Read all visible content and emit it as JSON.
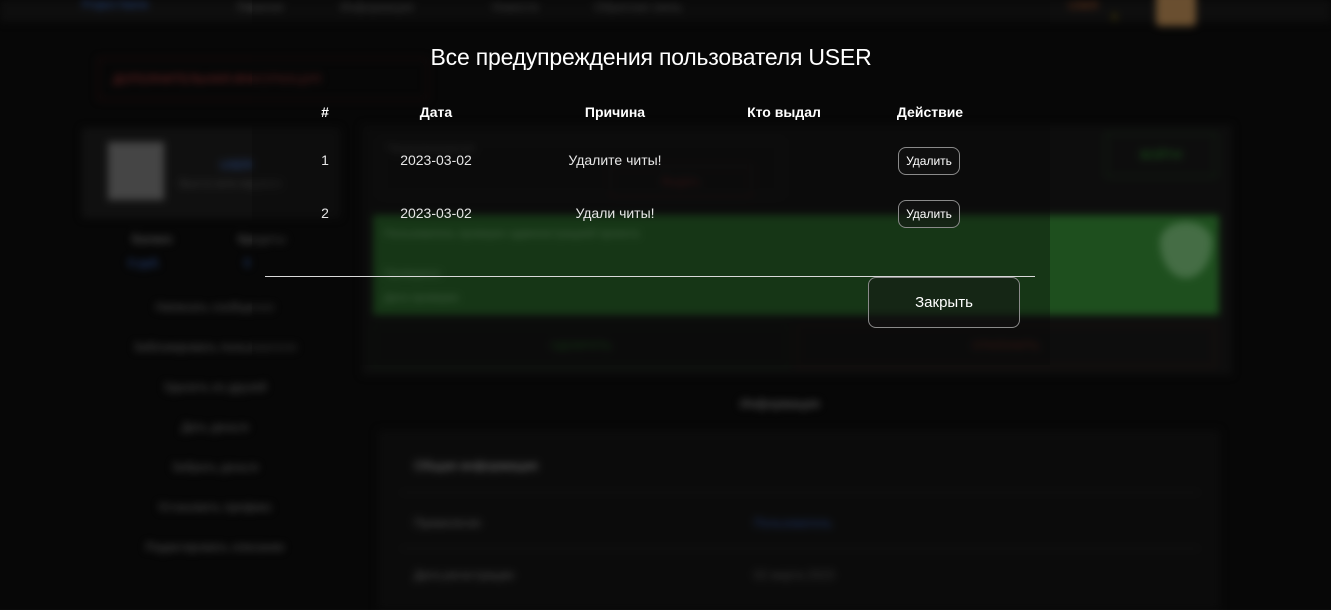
{
  "background": {
    "logo": "Project Name",
    "nav": [
      "Главная",
      "Информация",
      "Новости",
      "Обратная связь"
    ],
    "user_top": "USER",
    "gold": "0",
    "alert": "ДОПОЛНИТЕЛЬНАЯ ИНФОРМАЦИЯ",
    "profile": {
      "name": "USER",
      "subtitle": "Был в сети недавно",
      "stats": [
        {
          "label": "Баланс",
          "value": "0 руб."
        },
        {
          "label": "Кредиты",
          "value": "0"
        }
      ]
    },
    "left_menu": [
      "Написать сообщение",
      "Заблокировать пользователя",
      "Удалить из друзей",
      "Дать деньги",
      "Забрать деньги",
      "Установить префикс",
      "Редактировать описание"
    ],
    "main": {
      "field_label": "Предупреждения",
      "red_small": "Выдать",
      "green_btn": "ВОЙТИ",
      "green_lines": [
        "Пользователь проверен администрацией проекта",
        "Проверено",
        "Дата проверки"
      ],
      "green_action": "ОДОБРИТЬ",
      "red_action": "ОТКЛОНИТЬ"
    },
    "info": {
      "title": "Информация",
      "header": "Общая информация",
      "rows": [
        {
          "label": "Привилегия",
          "value": "Пользователь"
        },
        {
          "label": "Дата регистрации",
          "value": "02 марта 2023"
        }
      ]
    }
  },
  "modal": {
    "title": "Все предупреждения пользователя USER",
    "columns": [
      "#",
      "Дата",
      "Причина",
      "Кто выдал",
      "Действие"
    ],
    "rows": [
      {
        "num": "1",
        "date": "2023-03-02",
        "reason": "Удалите читы!",
        "issuer": "",
        "action": "Удалить"
      },
      {
        "num": "2",
        "date": "2023-03-02",
        "reason": "Удали читы!",
        "issuer": "",
        "action": "Удалить"
      }
    ],
    "close_label": "Закрыть"
  },
  "colors": {
    "background": "#0b0b0b",
    "green_banner": "#2f7a2f",
    "link_blue": "#3e6fd0",
    "danger_red": "#b03b3b"
  }
}
